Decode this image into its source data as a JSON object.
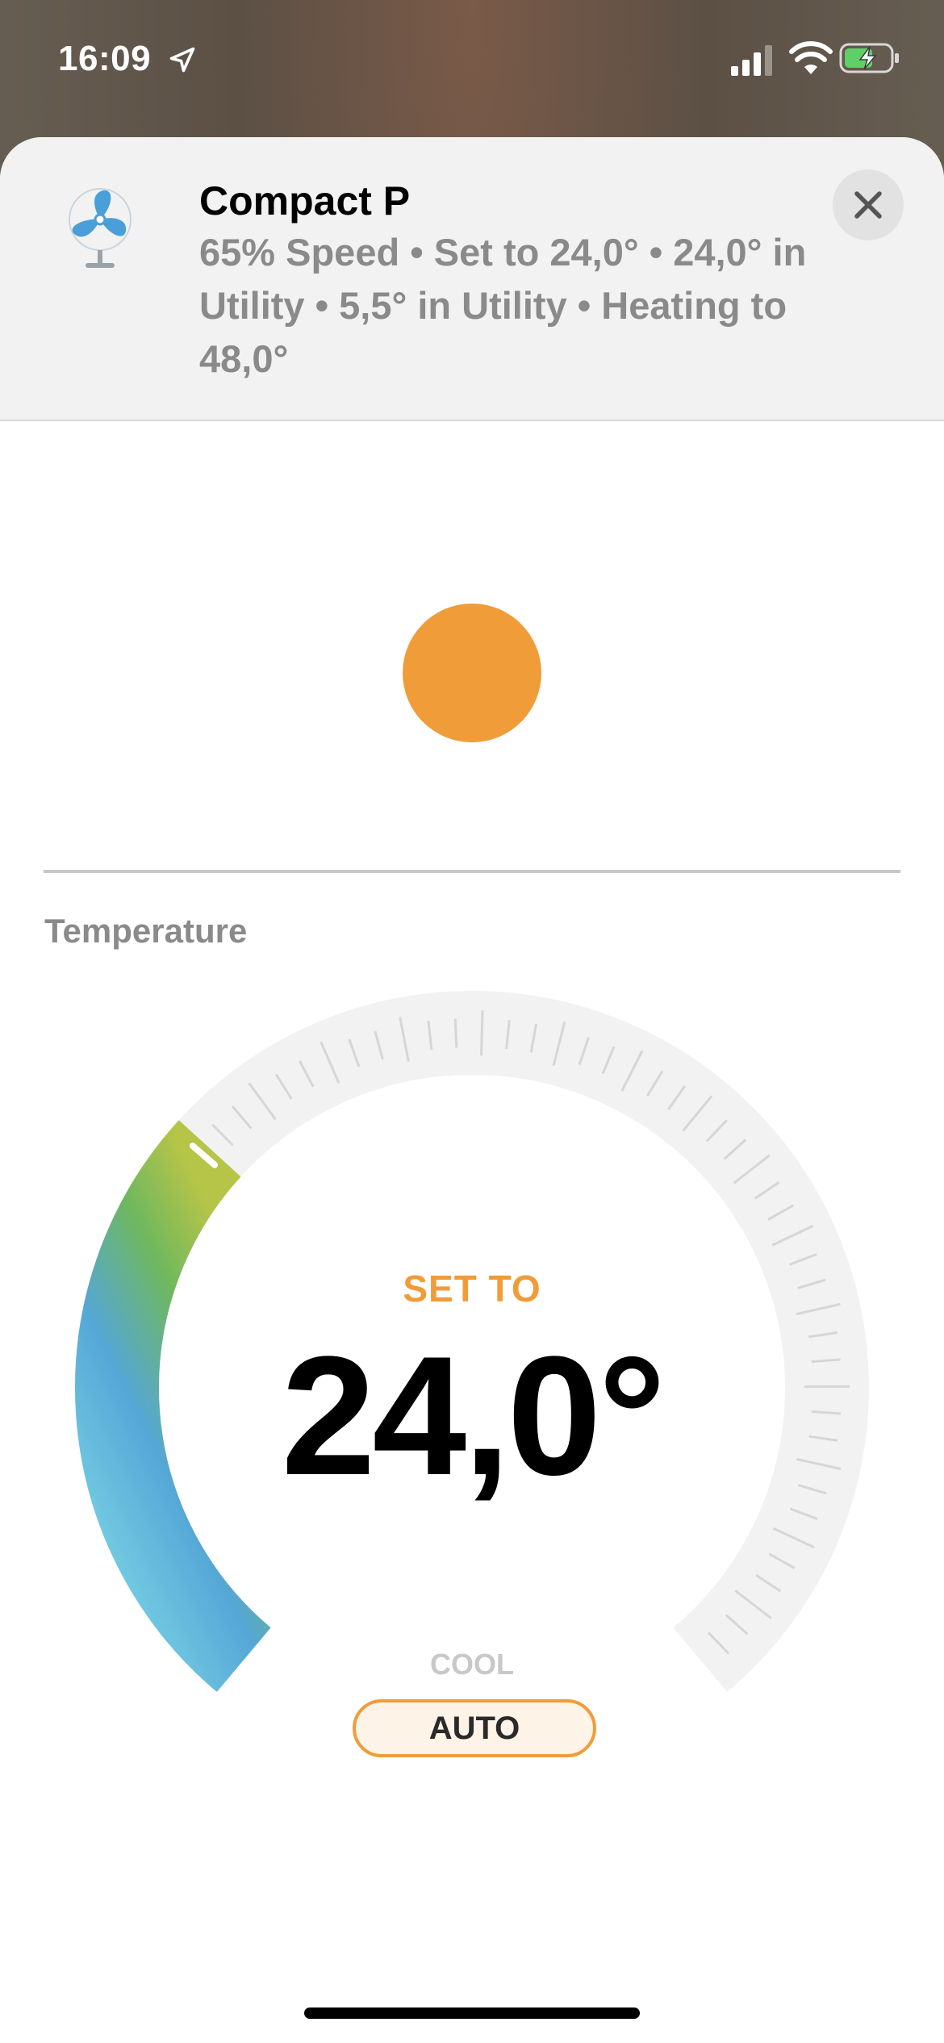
{
  "status_bar": {
    "time": "16:09",
    "icons": [
      "location-arrow-icon",
      "cellular-signal-icon",
      "wifi-icon",
      "battery-charging-icon"
    ]
  },
  "accessory": {
    "name": "Compact P",
    "status_line": "65% Speed • Set to 24,0° • 24,0° in Utility • 5,5° in Utility • Heating to 48,0°",
    "icon": "fan-icon",
    "close_icon": "close-icon"
  },
  "power": {
    "state": "on",
    "color": "#f09c38"
  },
  "temperature": {
    "section_label": "Temperature",
    "set_label": "SET TO",
    "value": "24,0°",
    "level": 0.33,
    "modes": {
      "cool": "COOL",
      "auto": "AUTO"
    },
    "selected_mode": "auto"
  },
  "colors": {
    "accent": "#f09c38",
    "cold": "#7fd9e6",
    "mid": "#55a7d6",
    "warm": "#6fb85e",
    "warmer": "#b6c448"
  }
}
